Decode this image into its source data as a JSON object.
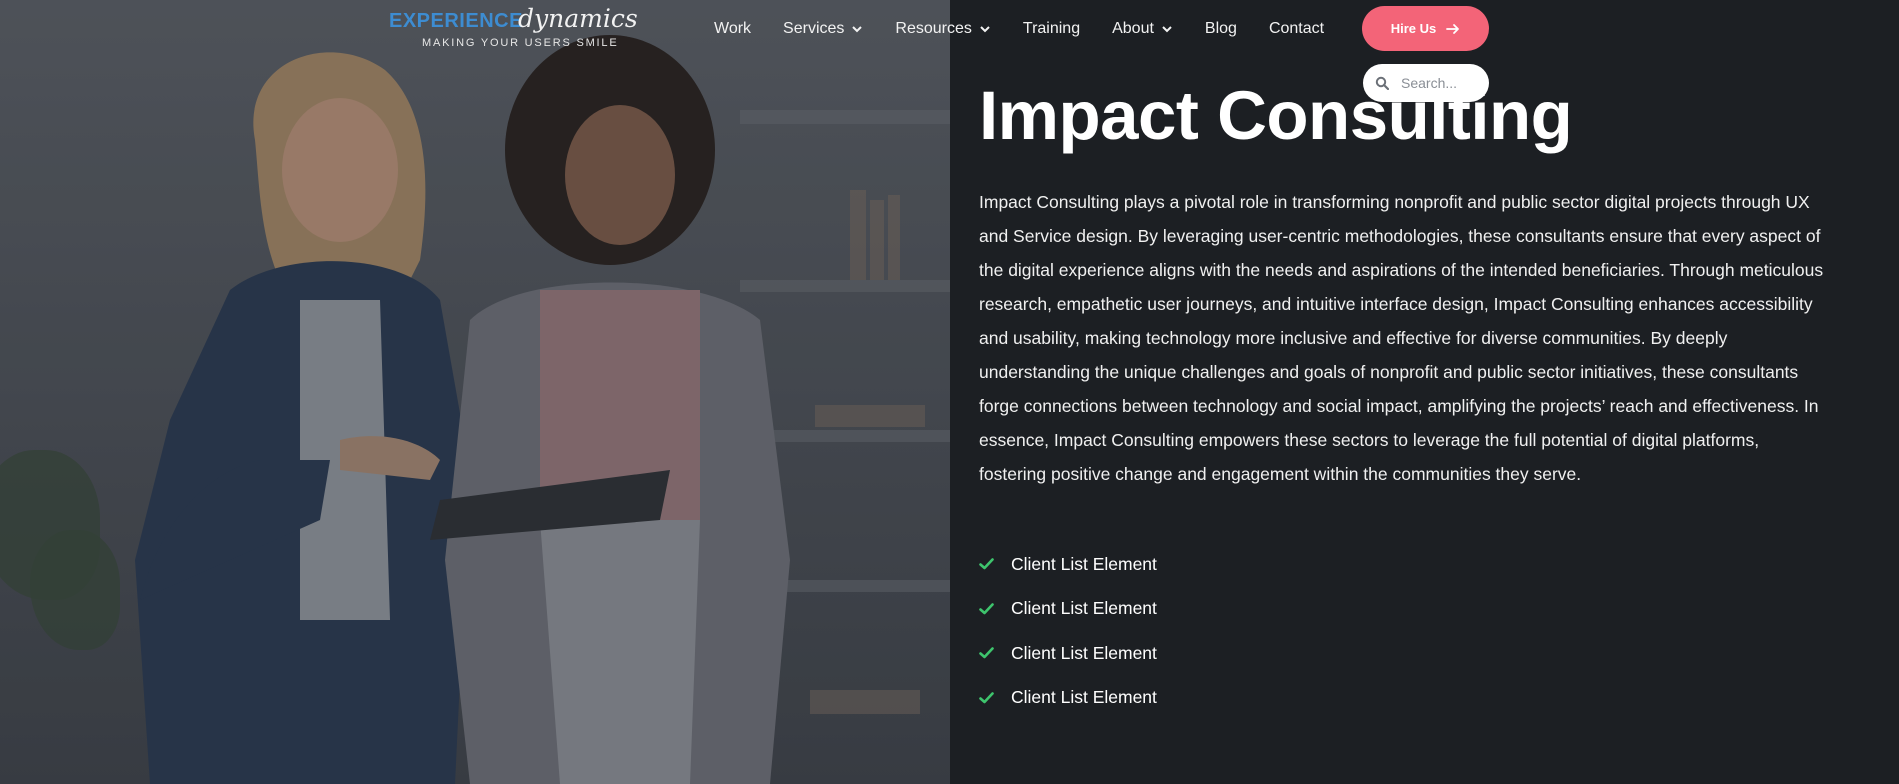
{
  "header": {
    "logo": {
      "word_1": "EXPERIENCE",
      "word_2": "dynamics",
      "tagline": "MAKING YOUR USERS SMILE"
    },
    "nav": [
      {
        "label": "Work",
        "dropdown": false
      },
      {
        "label": "Services",
        "dropdown": true
      },
      {
        "label": "Resources",
        "dropdown": true
      },
      {
        "label": "Training",
        "dropdown": false
      },
      {
        "label": "About",
        "dropdown": true
      },
      {
        "label": "Blog",
        "dropdown": false
      },
      {
        "label": "Contact",
        "dropdown": false
      }
    ],
    "hire_button": {
      "label": "Hire Us",
      "icon": "arrow-right-icon"
    },
    "search": {
      "placeholder": "Search...",
      "value": "",
      "icon": "search-icon"
    }
  },
  "main": {
    "title": "Impact Consulting",
    "description": "Impact Consulting plays a pivotal role in transforming nonprofit and public sector digital projects through UX and Service design. By leveraging user-centric methodologies, these consultants ensure that every aspect of the digital experience aligns with the needs and aspirations of the intended beneficiaries. Through meticulous research, empathetic user journeys, and intuitive interface design, Impact Consulting enhances accessibility and usability, making technology more inclusive and effective for diverse communities. By deeply understanding the unique challenges and goals of nonprofit and public sector initiatives, these consultants forge connections between technology and social impact, amplifying the projects’ reach and effectiveness. In essence, Impact Consulting empowers these sectors to leverage the full potential of digital platforms, fostering positive change and engagement within the communities they serve.",
    "client_list": [
      {
        "label": "Client List Element",
        "icon": "check-icon"
      },
      {
        "label": "Client List Element",
        "icon": "check-icon"
      },
      {
        "label": "Client List Element",
        "icon": "check-icon"
      },
      {
        "label": "Client List Element",
        "icon": "check-icon"
      }
    ]
  },
  "colors": {
    "background": "#1c1f23",
    "logo_accent": "#3d8cd1",
    "hire_button": "#f36478",
    "check": "#3ec46d"
  }
}
